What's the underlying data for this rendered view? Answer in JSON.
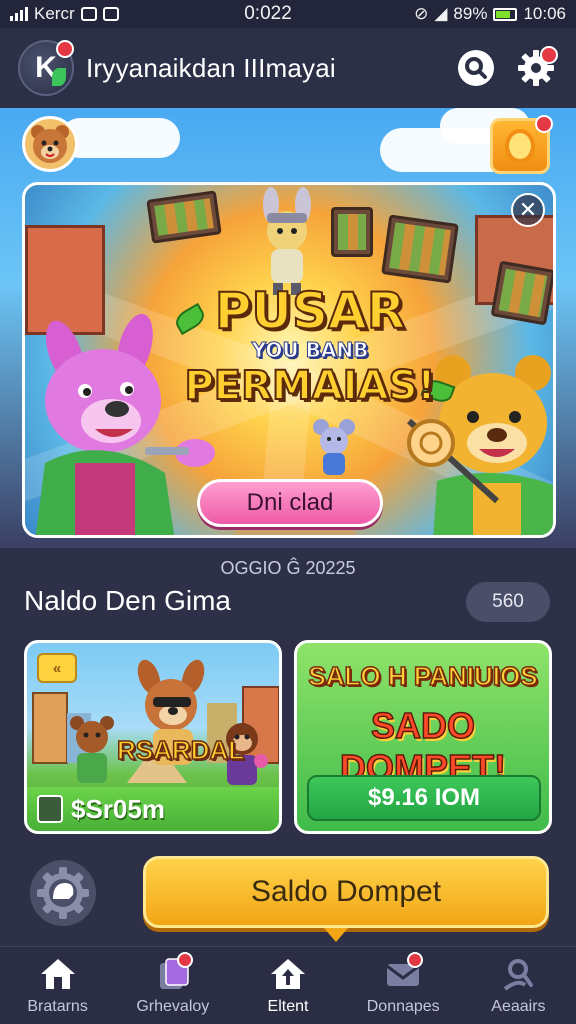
{
  "status": {
    "carrier": "Kercr",
    "time": "0:022",
    "battery": "89%",
    "clock": "10:06"
  },
  "header": {
    "title": "Iryyanaikdan IIImayai",
    "logo_letter": "K"
  },
  "banner": {
    "line1": "PUSAR",
    "line2": "YOU BANB",
    "line3": "PERMAIAS!",
    "cta": "Dni clad",
    "close": "✕"
  },
  "date": "OGGIO Ĝ 20225",
  "section": {
    "title": "Naldo Den Gima",
    "pill": "560"
  },
  "cards": {
    "left": {
      "badge": "«",
      "game_word": "RSARDAL",
      "footer": "$Sr05m"
    },
    "right": {
      "line1": "SALO H PANIUIOS",
      "line2": "SADO DOMPET!",
      "amount": "$9.16 IOM"
    }
  },
  "main_cta": "Saldo Dompet",
  "nav": [
    {
      "label": "Bratarns",
      "icon": "home-icon"
    },
    {
      "label": "Grhevaloy",
      "icon": "cards-icon"
    },
    {
      "label": "Eltent",
      "icon": "house-upload-icon"
    },
    {
      "label": "Donnapes",
      "icon": "mail-icon"
    },
    {
      "label": "Aeaairs",
      "icon": "profile-icon"
    }
  ],
  "colors": {
    "background": "#2d3047",
    "accent": "#f2a615",
    "badge": "#e53845",
    "cta_pink": "#ee5aa8",
    "card_green": "#3fbb4a"
  }
}
